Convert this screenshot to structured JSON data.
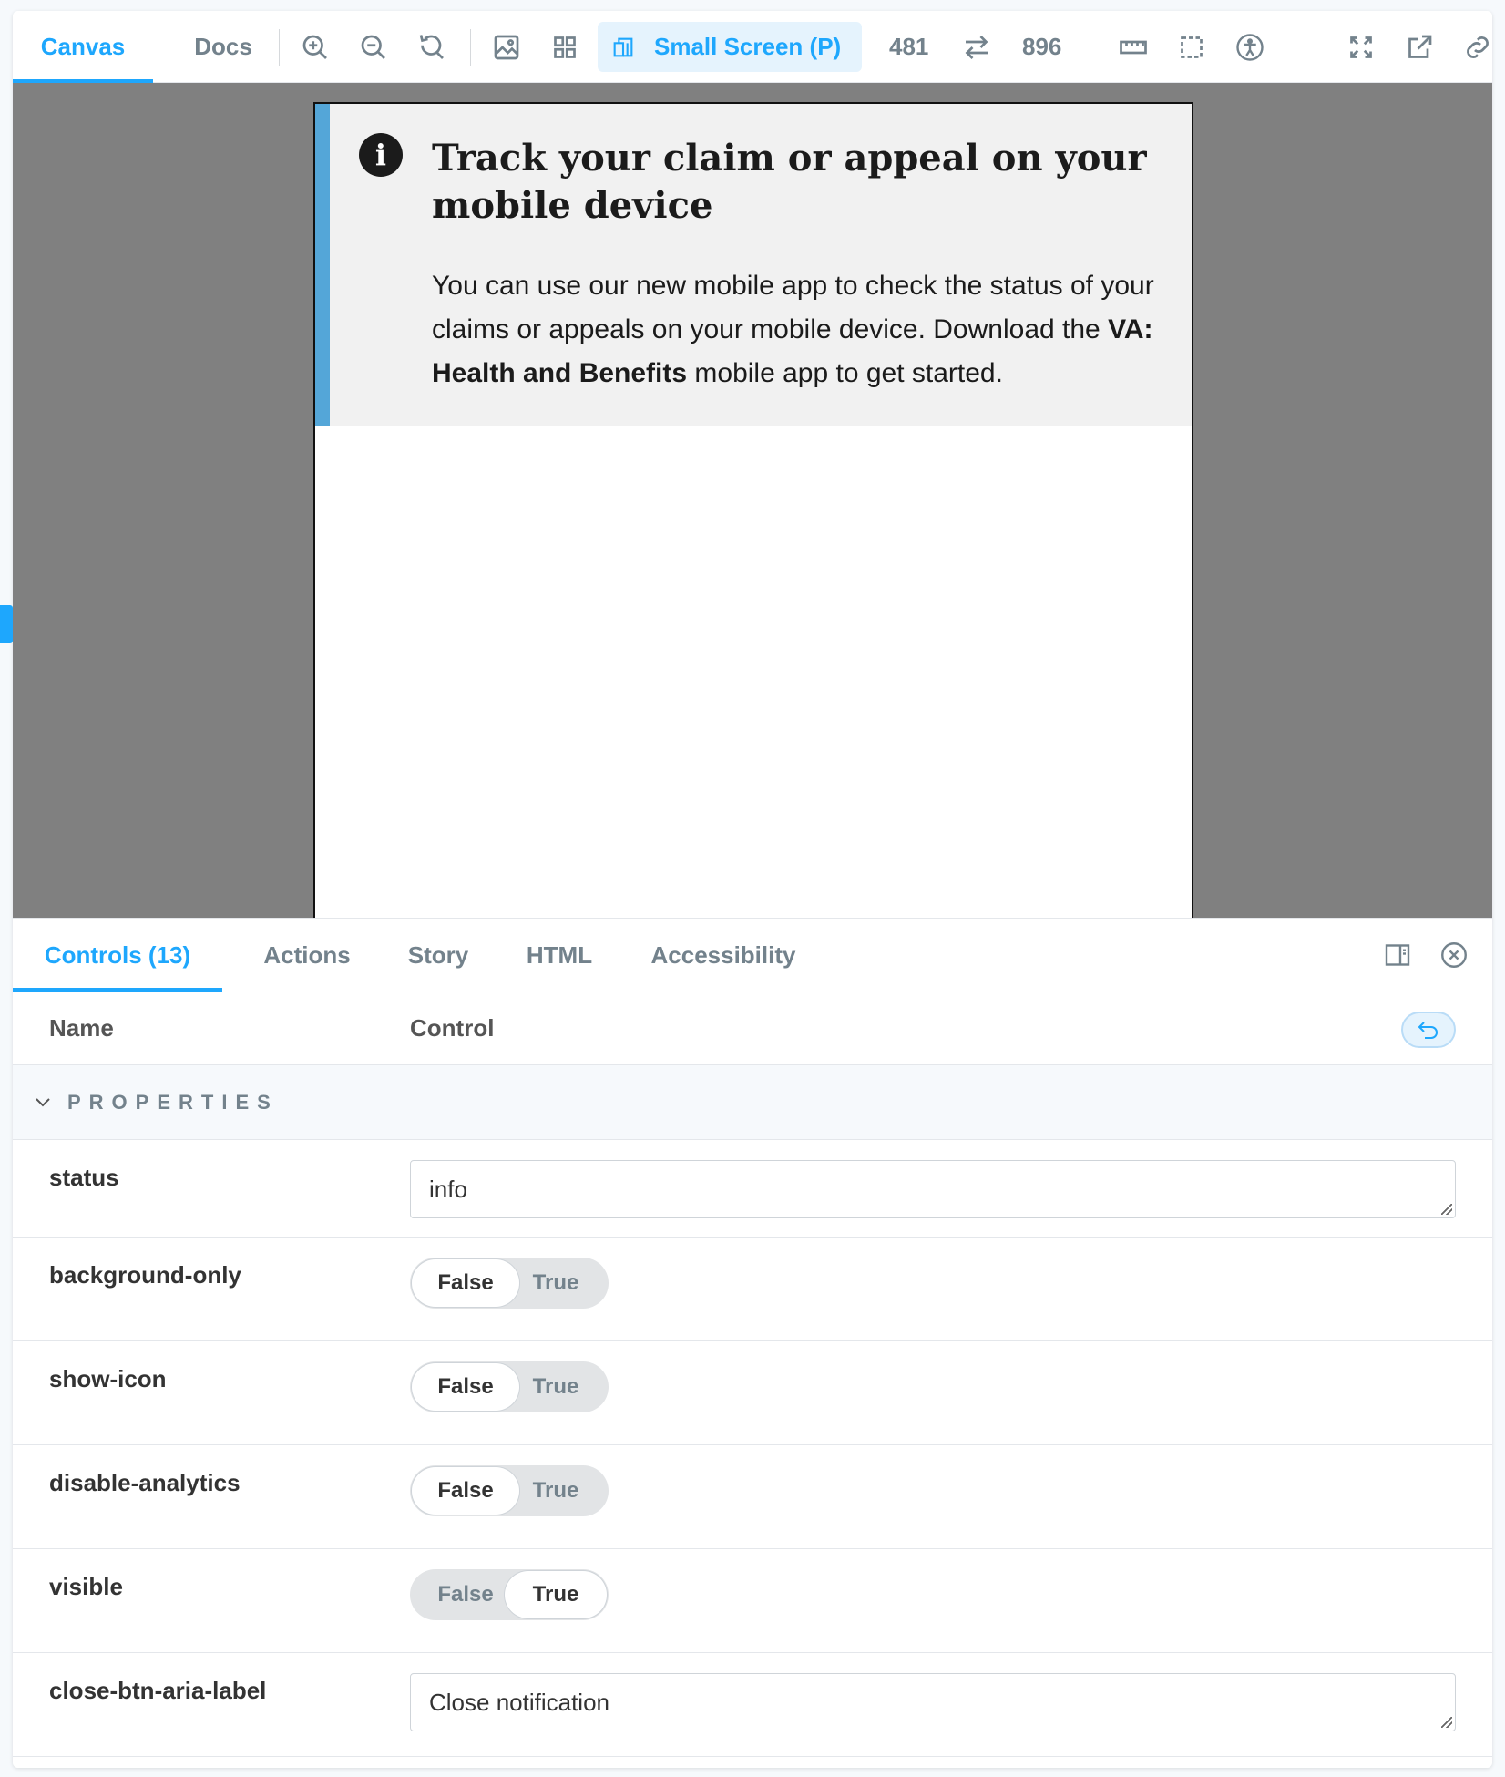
{
  "toolbar": {
    "tabs": [
      {
        "label": "Canvas",
        "active": true
      },
      {
        "label": "Docs",
        "active": false
      }
    ],
    "icons": [
      "zoom-in-icon",
      "zoom-out-icon",
      "zoom-reset-icon",
      "background-icon",
      "grid-icon",
      "viewport-icon",
      "rotate-icon",
      "measure-icon",
      "outline-icon",
      "accessibility-icon",
      "fullscreen-icon",
      "open-new-tab-icon",
      "copy-link-icon"
    ],
    "viewport_label": "Small Screen (P)",
    "width_value": "481",
    "height_value": "896",
    "accent_color": "#1ea7fd"
  },
  "preview": {
    "alert": {
      "status": "info",
      "title": "Track your claim or appeal on your mobile device",
      "body_before": "You can use our new mobile app to check the status of your claims or appeals on your mobile device. Download the ",
      "body_bold": "VA: Health and Benefits",
      "body_after": " mobile app to get started.",
      "border_color": "#54a6d8",
      "background_color": "#f1f1f1"
    }
  },
  "panel": {
    "tabs": [
      {
        "label": "Controls (13)",
        "active": true
      },
      {
        "label": "Actions",
        "active": false
      },
      {
        "label": "Story",
        "active": false
      },
      {
        "label": "HTML",
        "active": false
      },
      {
        "label": "Accessibility",
        "active": false
      }
    ],
    "header": {
      "name": "Name",
      "control": "Control"
    },
    "section_label": "PROPERTIES",
    "rows": [
      {
        "name": "status",
        "type": "text",
        "value": "info"
      },
      {
        "name": "background-only",
        "type": "boolean",
        "false_label": "False",
        "true_label": "True",
        "value": false
      },
      {
        "name": "show-icon",
        "type": "boolean",
        "false_label": "False",
        "true_label": "True",
        "value": false
      },
      {
        "name": "disable-analytics",
        "type": "boolean",
        "false_label": "False",
        "true_label": "True",
        "value": false
      },
      {
        "name": "visible",
        "type": "boolean",
        "false_label": "False",
        "true_label": "True",
        "value": true
      },
      {
        "name": "close-btn-aria-label",
        "type": "text",
        "value": "Close notification"
      }
    ]
  }
}
